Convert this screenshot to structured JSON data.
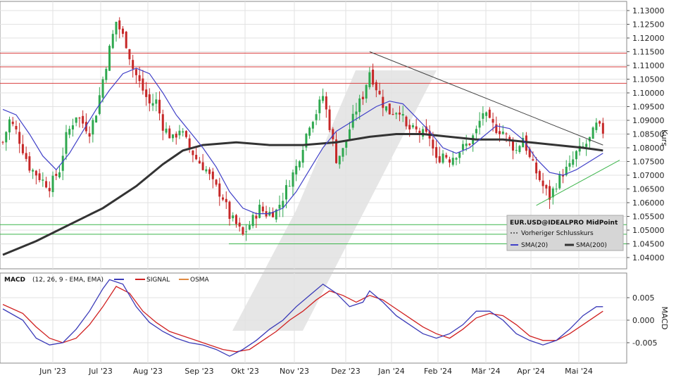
{
  "chart_data": [
    {
      "type": "candlestick",
      "ylabel": "Kurs",
      "ylim": [
        1.04,
        1.13
      ],
      "y_ticks": [
        "1.04000",
        "1.04500",
        "1.05000",
        "1.05500",
        "1.06000",
        "1.06500",
        "1.07000",
        "1.07500",
        "1.08000",
        "1.08500",
        "1.09000",
        "1.09500",
        "1.10000",
        "1.10500",
        "1.11000",
        "1.11500",
        "1.12000",
        "1.12500",
        "1.13000"
      ],
      "x_ticks": [
        "Jun '23",
        "Jul '23",
        "Aug '23",
        "Sep '23",
        "Okt '23",
        "Nov '23",
        "Dez '23",
        "Jan '24",
        "Feb '24",
        "Mär '24",
        "Apr '24",
        "Mai '24"
      ],
      "price_path": [
        [
          0,
          1.082
        ],
        [
          2,
          1.09
        ],
        [
          4,
          1.086
        ],
        [
          8,
          1.073
        ],
        [
          12,
          1.068
        ],
        [
          14,
          1.066
        ],
        [
          17,
          1.072
        ],
        [
          19,
          1.084
        ],
        [
          22,
          1.092
        ],
        [
          26,
          1.086
        ],
        [
          28,
          1.093
        ],
        [
          30,
          1.105
        ],
        [
          32,
          1.116
        ],
        [
          34,
          1.126
        ],
        [
          37,
          1.118
        ],
        [
          39,
          1.109
        ],
        [
          42,
          1.101
        ],
        [
          44,
          1.096
        ],
        [
          46,
          1.097
        ],
        [
          48,
          1.088
        ],
        [
          51,
          1.083
        ],
        [
          53,
          1.087
        ],
        [
          56,
          1.08
        ],
        [
          58,
          1.076
        ],
        [
          61,
          1.072
        ],
        [
          63,
          1.067
        ],
        [
          66,
          1.062
        ],
        [
          68,
          1.055
        ],
        [
          70,
          1.052
        ],
        [
          72,
          1.048
        ],
        [
          75,
          1.054
        ],
        [
          77,
          1.058
        ],
        [
          79,
          1.056
        ],
        [
          82,
          1.057
        ],
        [
          84,
          1.062
        ],
        [
          86,
          1.068
        ],
        [
          88,
          1.073
        ],
        [
          90,
          1.081
        ],
        [
          92,
          1.089
        ],
        [
          94,
          1.093
        ],
        [
          96,
          1.099
        ],
        [
          98,
          1.088
        ],
        [
          100,
          1.076
        ],
        [
          102,
          1.079
        ],
        [
          104,
          1.087
        ],
        [
          106,
          1.094
        ],
        [
          108,
          1.099
        ],
        [
          110,
          1.108
        ],
        [
          112,
          1.102
        ],
        [
          114,
          1.096
        ],
        [
          116,
          1.093
        ],
        [
          119,
          1.094
        ],
        [
          121,
          1.087
        ],
        [
          124,
          1.086
        ],
        [
          126,
          1.085
        ],
        [
          128,
          1.084
        ],
        [
          130,
          1.075
        ],
        [
          132,
          1.078
        ],
        [
          134,
          1.076
        ],
        [
          137,
          1.079
        ],
        [
          140,
          1.082
        ],
        [
          142,
          1.086
        ],
        [
          144,
          1.093
        ],
        [
          146,
          1.089
        ],
        [
          148,
          1.087
        ],
        [
          150,
          1.086
        ],
        [
          152,
          1.082
        ],
        [
          154,
          1.079
        ],
        [
          156,
          1.084
        ],
        [
          158,
          1.076
        ],
        [
          160,
          1.071
        ],
        [
          162,
          1.066
        ],
        [
          164,
          1.062
        ],
        [
          166,
          1.067
        ],
        [
          168,
          1.071
        ],
        [
          170,
          1.073
        ],
        [
          172,
          1.078
        ],
        [
          174,
          1.08
        ],
        [
          176,
          1.083
        ],
        [
          178,
          1.088
        ],
        [
          180,
          1.086
        ]
      ],
      "sma20_path": [
        [
          0,
          1.094
        ],
        [
          4,
          1.092
        ],
        [
          8,
          1.085
        ],
        [
          12,
          1.077
        ],
        [
          16,
          1.072
        ],
        [
          20,
          1.078
        ],
        [
          24,
          1.086
        ],
        [
          28,
          1.094
        ],
        [
          32,
          1.101
        ],
        [
          36,
          1.107
        ],
        [
          40,
          1.109
        ],
        [
          44,
          1.107
        ],
        [
          48,
          1.1
        ],
        [
          52,
          1.092
        ],
        [
          56,
          1.086
        ],
        [
          60,
          1.08
        ],
        [
          64,
          1.073
        ],
        [
          68,
          1.064
        ],
        [
          72,
          1.058
        ],
        [
          76,
          1.056
        ],
        [
          80,
          1.056
        ],
        [
          84,
          1.058
        ],
        [
          88,
          1.064
        ],
        [
          92,
          1.072
        ],
        [
          96,
          1.08
        ],
        [
          100,
          1.086
        ],
        [
          104,
          1.089
        ],
        [
          108,
          1.092
        ],
        [
          112,
          1.095
        ],
        [
          116,
          1.097
        ],
        [
          120,
          1.096
        ],
        [
          124,
          1.091
        ],
        [
          128,
          1.086
        ],
        [
          132,
          1.08
        ],
        [
          136,
          1.078
        ],
        [
          140,
          1.08
        ],
        [
          144,
          1.084
        ],
        [
          148,
          1.088
        ],
        [
          152,
          1.087
        ],
        [
          156,
          1.083
        ],
        [
          160,
          1.076
        ],
        [
          164,
          1.071
        ],
        [
          168,
          1.07
        ],
        [
          172,
          1.072
        ],
        [
          176,
          1.075
        ],
        [
          180,
          1.078
        ]
      ],
      "sma200_path": [
        [
          0,
          1.041
        ],
        [
          10,
          1.046
        ],
        [
          20,
          1.052
        ],
        [
          30,
          1.058
        ],
        [
          40,
          1.066
        ],
        [
          48,
          1.074
        ],
        [
          54,
          1.079
        ],
        [
          60,
          1.081
        ],
        [
          70,
          1.082
        ],
        [
          80,
          1.081
        ],
        [
          90,
          1.081
        ],
        [
          100,
          1.082
        ],
        [
          110,
          1.084
        ],
        [
          118,
          1.085
        ],
        [
          126,
          1.085
        ],
        [
          134,
          1.084
        ],
        [
          142,
          1.083
        ],
        [
          150,
          1.083
        ],
        [
          158,
          1.082
        ],
        [
          166,
          1.081
        ],
        [
          174,
          1.08
        ],
        [
          180,
          1.079
        ]
      ],
      "horizontal_red": [
        1.1145,
        1.1095,
        1.1035
      ],
      "horizontal_green": [
        1.052,
        1.0485,
        1.045
      ],
      "trendlines": [
        {
          "color": "#444444",
          "from": [
            110,
            1.115
          ],
          "to": [
            180,
            1.081
          ]
        },
        {
          "color": "#3bb54a",
          "from": [
            160,
            1.059
          ],
          "to": [
            185,
            1.0755
          ]
        }
      ],
      "legend": {
        "title": "EUR.USD@IDEALPRO MidPoint",
        "prev_close": "Vorheriger Schlusskurs",
        "sma20": "SMA(20)",
        "sma200": "SMA(200)"
      }
    },
    {
      "type": "line",
      "title": "MACD",
      "params": "(12, 26, 9 - EMA, EMA)",
      "series": [
        {
          "name": "MACD",
          "color": "#3a3ab8"
        },
        {
          "name": "SIGNAL",
          "color": "#d02020"
        },
        {
          "name": "OSMA",
          "color": "#e08a40"
        }
      ],
      "ylabel": "MACD",
      "ylim": [
        -0.0085,
        0.009
      ],
      "y_ticks": [
        "0.005",
        "0.000",
        "-0.005"
      ],
      "macd_path": [
        [
          0,
          0.0025
        ],
        [
          6,
          0.0
        ],
        [
          10,
          -0.004
        ],
        [
          14,
          -0.0055
        ],
        [
          18,
          -0.005
        ],
        [
          22,
          -0.002
        ],
        [
          26,
          0.002
        ],
        [
          30,
          0.007
        ],
        [
          32,
          0.009
        ],
        [
          36,
          0.008
        ],
        [
          40,
          0.003
        ],
        [
          44,
          -0.0005
        ],
        [
          48,
          -0.0025
        ],
        [
          52,
          -0.004
        ],
        [
          56,
          -0.005
        ],
        [
          60,
          -0.0055
        ],
        [
          64,
          -0.0065
        ],
        [
          68,
          -0.008
        ],
        [
          72,
          -0.0065
        ],
        [
          76,
          -0.0045
        ],
        [
          80,
          -0.002
        ],
        [
          84,
          0.0
        ],
        [
          88,
          0.003
        ],
        [
          92,
          0.0055
        ],
        [
          96,
          0.008
        ],
        [
          100,
          0.006
        ],
        [
          104,
          0.003
        ],
        [
          108,
          0.004
        ],
        [
          110,
          0.0065
        ],
        [
          114,
          0.004
        ],
        [
          118,
          0.001
        ],
        [
          122,
          -0.001
        ],
        [
          126,
          -0.003
        ],
        [
          130,
          -0.004
        ],
        [
          134,
          -0.003
        ],
        [
          138,
          -0.001
        ],
        [
          142,
          0.002
        ],
        [
          146,
          0.002
        ],
        [
          150,
          0.0
        ],
        [
          154,
          -0.003
        ],
        [
          158,
          -0.0045
        ],
        [
          162,
          -0.0055
        ],
        [
          166,
          -0.0045
        ],
        [
          170,
          -0.002
        ],
        [
          174,
          0.001
        ],
        [
          178,
          0.003
        ],
        [
          180,
          0.003
        ]
      ],
      "signal_path": [
        [
          0,
          0.0035
        ],
        [
          6,
          0.0015
        ],
        [
          10,
          -0.0015
        ],
        [
          14,
          -0.004
        ],
        [
          18,
          -0.005
        ],
        [
          22,
          -0.004
        ],
        [
          26,
          -0.001
        ],
        [
          30,
          0.003
        ],
        [
          34,
          0.0075
        ],
        [
          38,
          0.006
        ],
        [
          42,
          0.002
        ],
        [
          46,
          -0.0005
        ],
        [
          50,
          -0.0025
        ],
        [
          54,
          -0.0035
        ],
        [
          58,
          -0.0045
        ],
        [
          62,
          -0.0055
        ],
        [
          66,
          -0.0065
        ],
        [
          70,
          -0.007
        ],
        [
          74,
          -0.0065
        ],
        [
          78,
          -0.0045
        ],
        [
          82,
          -0.0025
        ],
        [
          86,
          0.0
        ],
        [
          90,
          0.002
        ],
        [
          94,
          0.0045
        ],
        [
          98,
          0.0065
        ],
        [
          102,
          0.0055
        ],
        [
          106,
          0.004
        ],
        [
          110,
          0.0055
        ],
        [
          114,
          0.0045
        ],
        [
          118,
          0.0025
        ],
        [
          122,
          0.0005
        ],
        [
          126,
          -0.0015
        ],
        [
          130,
          -0.003
        ],
        [
          134,
          -0.004
        ],
        [
          138,
          -0.002
        ],
        [
          142,
          0.0005
        ],
        [
          146,
          0.0015
        ],
        [
          150,
          0.001
        ],
        [
          154,
          -0.001
        ],
        [
          158,
          -0.0035
        ],
        [
          162,
          -0.0045
        ],
        [
          166,
          -0.0045
        ],
        [
          170,
          -0.003
        ],
        [
          174,
          -0.001
        ],
        [
          178,
          0.001
        ],
        [
          180,
          0.002
        ]
      ]
    }
  ]
}
